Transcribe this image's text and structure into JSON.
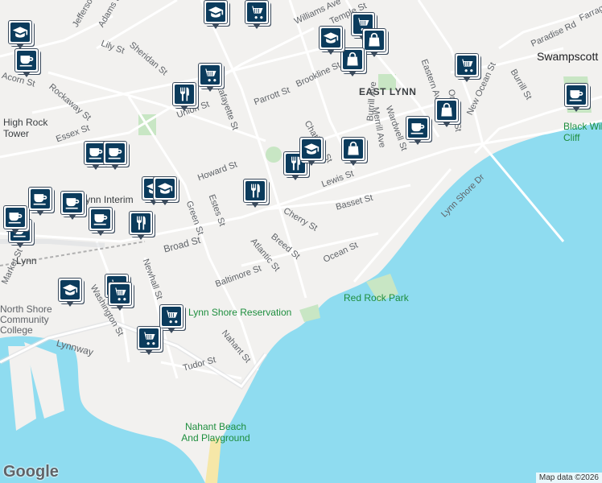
{
  "colors": {
    "water": "#8fdcf0",
    "land": "#f2f1ef",
    "park": "#c8e6c4",
    "road": "#ffffff",
    "pin_fill": "#0b3b5c"
  },
  "labels": {
    "street_labels": [
      "Jefferson St",
      "Adams St",
      "Lily St",
      "Sheridan St",
      "Rockaway St",
      "Essex St",
      "Union St",
      "Lafayette St",
      "Parrott St",
      "Williams Ave",
      "Brookline St",
      "Temple St",
      "Chatham St",
      "Howard St",
      "Lewis St",
      "Basset St",
      "Cherry St",
      "Breed St",
      "Atlantic St",
      "Ocean St",
      "Green St",
      "Estes St",
      "Broad St",
      "Baltimore St",
      "Newhall St",
      "Washington St",
      "Nahant St",
      "Tudor St",
      "Lynnway",
      "Eastern Ave",
      "New Ocean St",
      "Burrill St",
      "Burrill Ave",
      "Merrill Ave",
      "Wardwell St",
      "Lynn Shore Dr",
      "Paradise Rd",
      "Farragut Rd",
      "Acorn St",
      "Market St",
      "Orchard St"
    ],
    "east_lynn": "EAST LYNN",
    "swampscott": "Swampscott",
    "high_rock_tower": "High Rock Tower",
    "black_will_cliff": "Black Wills Cliff",
    "lynn_interim": "Lynn Interim",
    "lynn_station": "Lynn",
    "north_shore_cc": "North Shore Community College",
    "red_rock_park": "Red Rock Park",
    "lynn_shore_reservation": "Lynn Shore Reservation",
    "nahant_beach": "Nahant Beach And Playground"
  },
  "pins": [
    {
      "icon": "school-icon",
      "type": "school"
    },
    {
      "icon": "coffee-icon",
      "type": "cafe"
    },
    {
      "icon": "school-icon",
      "type": "school"
    },
    {
      "icon": "cart-icon",
      "type": "grocery"
    },
    {
      "icon": "cart-icon",
      "type": "grocery"
    },
    {
      "icon": "school-icon",
      "type": "school"
    },
    {
      "icon": "cart-icon",
      "type": "grocery"
    },
    {
      "icon": "bag-icon",
      "type": "shopping"
    },
    {
      "icon": "cart-icon",
      "type": "grocery"
    },
    {
      "icon": "restaurant-icon",
      "type": "restaurant"
    },
    {
      "icon": "coffee-icon",
      "type": "cafe"
    },
    {
      "icon": "coffee-icon",
      "type": "cafe"
    },
    {
      "icon": "bag-icon",
      "type": "shopping"
    },
    {
      "icon": "restaurant-icon",
      "type": "restaurant"
    },
    {
      "icon": "school-icon",
      "type": "school"
    },
    {
      "icon": "bag-icon",
      "type": "shopping"
    },
    {
      "icon": "bag-icon",
      "type": "shopping"
    },
    {
      "icon": "coffee-icon",
      "type": "cafe"
    },
    {
      "icon": "coffee-icon",
      "type": "cafe"
    },
    {
      "icon": "school-icon",
      "type": "school"
    },
    {
      "icon": "coffee-icon",
      "type": "cafe"
    },
    {
      "icon": "coffee-icon",
      "type": "cafe"
    },
    {
      "icon": "restaurant-icon",
      "type": "restaurant"
    },
    {
      "icon": "coffee-icon",
      "type": "cafe"
    },
    {
      "icon": "school-icon",
      "type": "school"
    },
    {
      "icon": "cart-icon",
      "type": "grocery"
    },
    {
      "icon": "cart-icon",
      "type": "grocery"
    },
    {
      "icon": "cart-icon",
      "type": "grocery"
    },
    {
      "icon": "cart-icon",
      "type": "grocery"
    },
    {
      "icon": "restaurant-icon",
      "type": "restaurant"
    },
    {
      "icon": "coffee-icon",
      "type": "cafe"
    },
    {
      "icon": "school-icon",
      "type": "school"
    },
    {
      "icon": "coffee-icon",
      "type": "cafe"
    }
  ],
  "footer": {
    "google": "Google",
    "attribution": "Map data ©2026"
  }
}
